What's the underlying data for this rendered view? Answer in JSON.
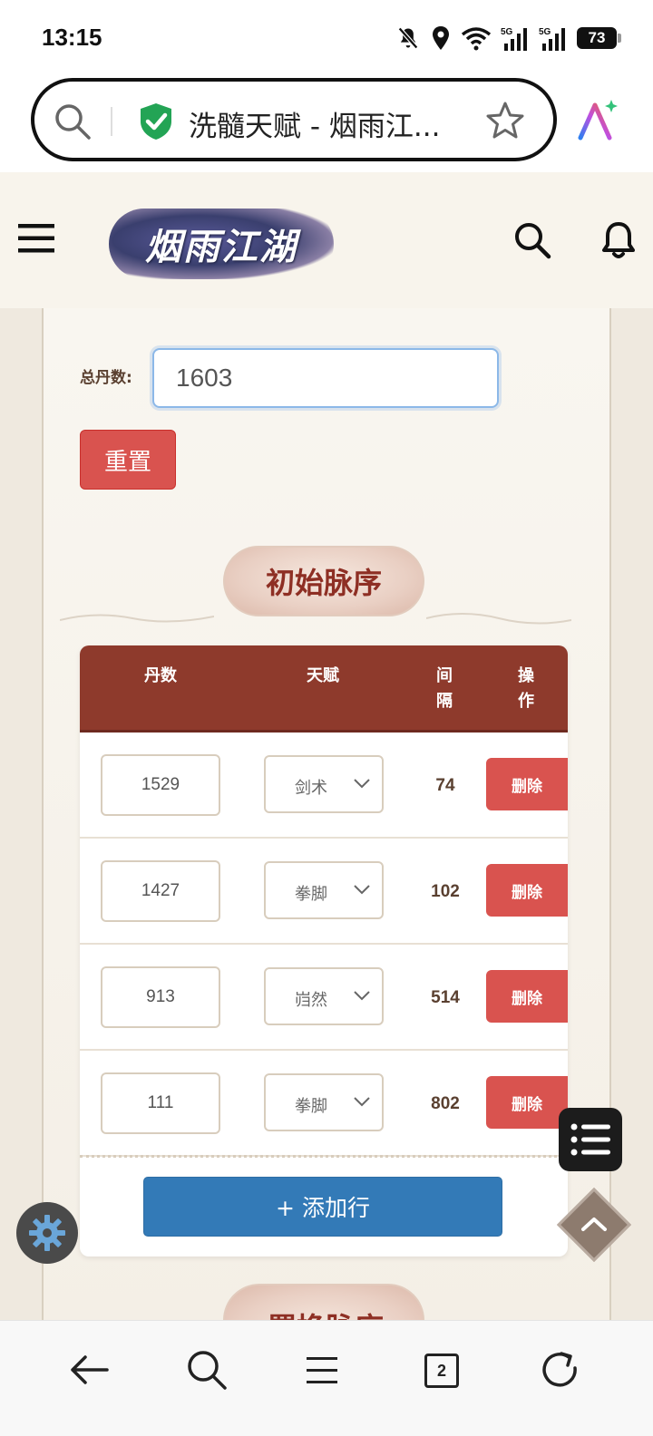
{
  "status_bar": {
    "time": "13:15",
    "battery": "73",
    "signal_label_1": "5G",
    "signal_label_2": "5G"
  },
  "browser": {
    "tab_title": "洗髓天赋 - 烟雨江...",
    "tab_count": "2",
    "icons": [
      "search-icon",
      "shield-check-icon",
      "star-icon",
      "ai-assistant-icon"
    ]
  },
  "site": {
    "logo_text": "烟雨江湖"
  },
  "form": {
    "total_label": "总丹数:",
    "total_value": "1603",
    "reset_label": "重置"
  },
  "section1": {
    "title": "初始脉序"
  },
  "table": {
    "headers": {
      "dan": "丹数",
      "tian": "天赋",
      "jian_1": "间",
      "jian_2": "隔",
      "cao_1": "操",
      "cao_2": "作"
    },
    "rows": [
      {
        "dan": "1529",
        "talent": "剑术",
        "gap": "74",
        "action": "删除"
      },
      {
        "dan": "1427",
        "talent": "拳脚",
        "gap": "102",
        "action": "删除"
      },
      {
        "dan": "913",
        "talent": "岿然",
        "gap": "514",
        "action": "删除"
      },
      {
        "dan": "111",
        "talent": "拳脚",
        "gap": "802",
        "action": "删除"
      }
    ],
    "add_row_label": "+ 添加行"
  },
  "section2": {
    "title": "置换脉序"
  },
  "colors": {
    "header_red": "#8e3a2c",
    "danger": "#d9534f",
    "primary": "#337ab7",
    "title_text": "#8e2f24"
  }
}
